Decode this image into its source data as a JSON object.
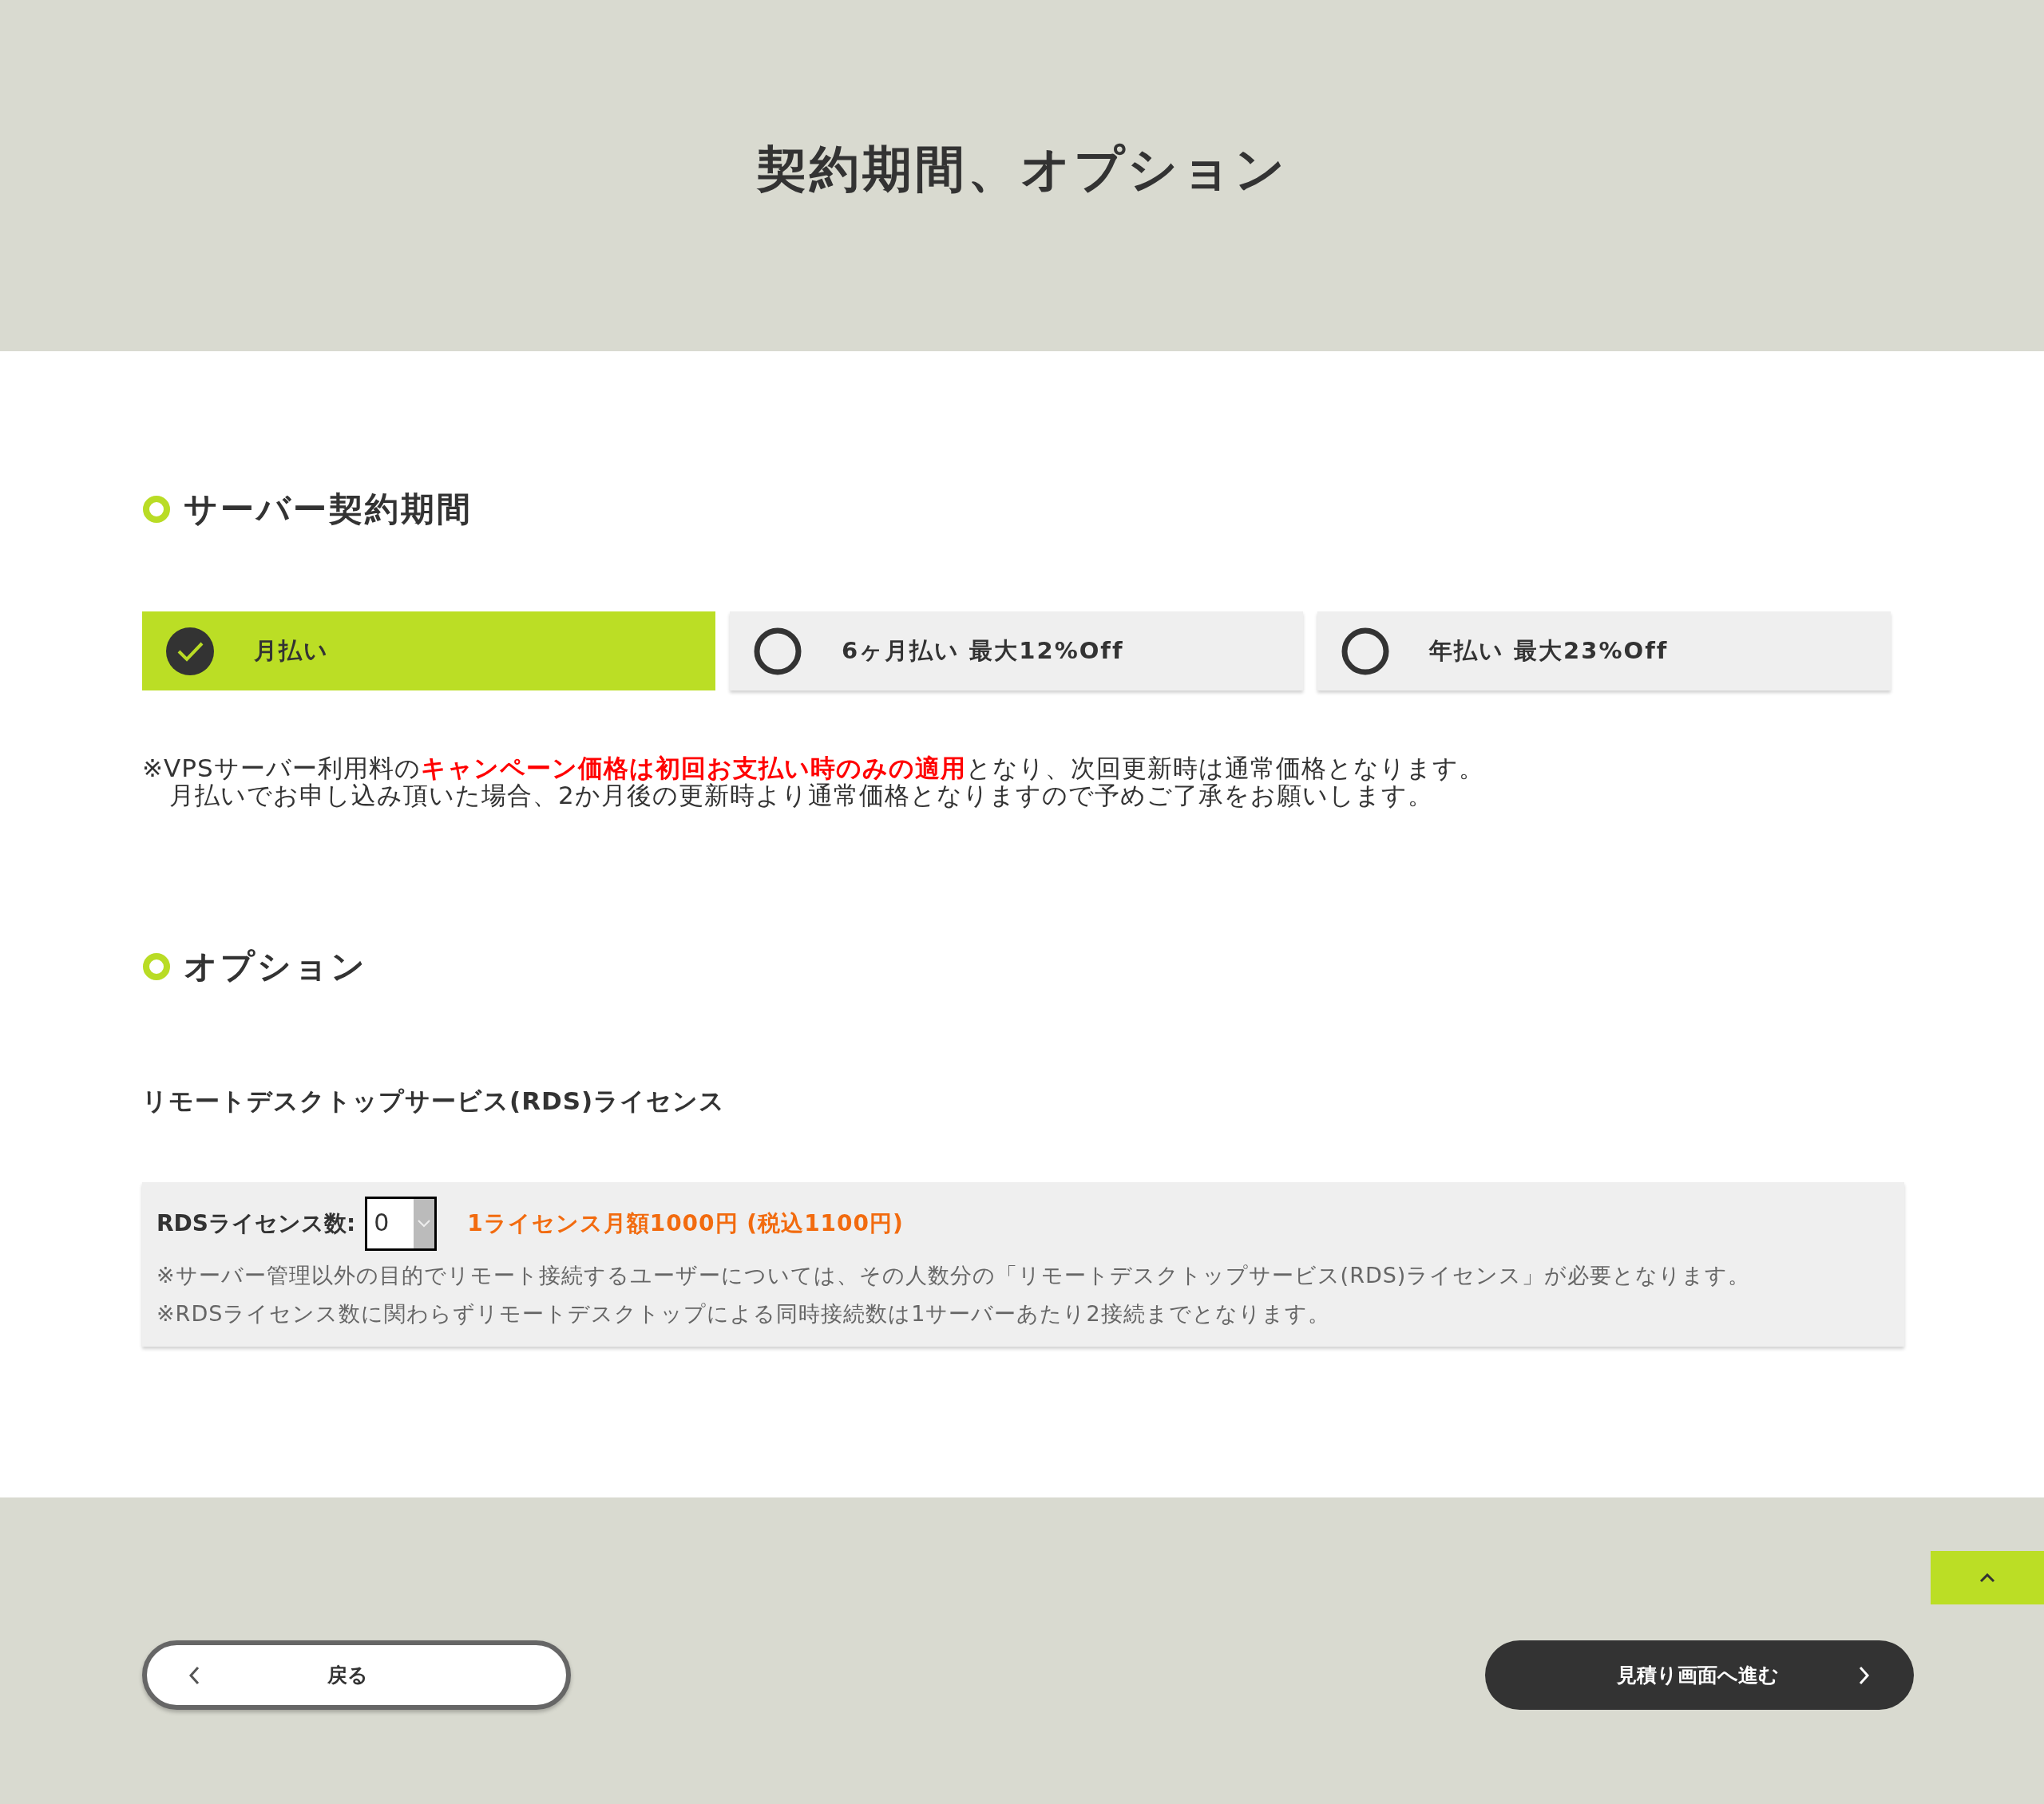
{
  "page_title": "契約期間、オプション",
  "contract": {
    "heading": "サーバー契約期間",
    "options": [
      {
        "label": "月払い",
        "selected": true
      },
      {
        "label": "6ヶ月払い 最大12%Off",
        "selected": false
      },
      {
        "label": "年払い 最大23%Off",
        "selected": false
      }
    ],
    "notes": [
      "※VPSサーバー利用料の**キャンペーン価格は初回お支払い時のみの適用**となり、次回更新時は通常価格となります。",
      "月払いでお申し込み頂いた場合、2か月後の更新時より通常価格となりますので予めご了承をお願いします。"
    ]
  },
  "options_section": {
    "heading": "オプション",
    "subheading": "リモートデスクトップサービス(RDS)ライセンス",
    "rds": {
      "label": "RDSライセンス数:",
      "value": "0",
      "price": "1ライセンス月額1000円 (税込1100円)",
      "notes": [
        "※サーバー管理以外の目的でリモート接続するユーザーについては、その人数分の「リモートデスクトップサービス(RDS)ライセンス」が必要となります。",
        "※RDSライセンス数に関わらずリモートデスクトップによる同時接続数は1サーバーあたり2接続までとなります。"
      ]
    }
  },
  "footer": {
    "back": "戻る",
    "next": "見積り画面へ進む"
  }
}
